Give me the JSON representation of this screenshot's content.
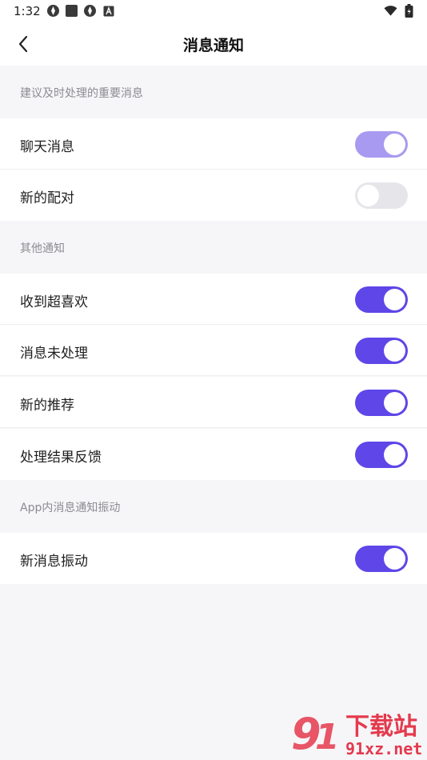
{
  "status_bar": {
    "time": "1:32"
  },
  "header": {
    "title": "消息通知"
  },
  "sections": [
    {
      "label": "建议及时处理的重要消息",
      "items": [
        {
          "label": "聊天消息",
          "enabled": true,
          "color": "#a89af0"
        },
        {
          "label": "新的配对",
          "enabled": false,
          "color": "#e6e6ea"
        }
      ]
    },
    {
      "label": "其他通知",
      "items": [
        {
          "label": "收到超喜欢",
          "enabled": true,
          "color": "#5e46e8"
        },
        {
          "label": "消息未处理",
          "enabled": true,
          "color": "#5e46e8"
        },
        {
          "label": "新的推荐",
          "enabled": true,
          "color": "#5e46e8"
        },
        {
          "label": "处理结果反馈",
          "enabled": true,
          "color": "#5e46e8"
        }
      ]
    },
    {
      "label": "App内消息通知振动",
      "items": [
        {
          "label": "新消息振动",
          "enabled": true,
          "color": "#5e46e8"
        }
      ]
    }
  ],
  "watermark": {
    "brand": "下载站",
    "domain": "91xz.net"
  }
}
